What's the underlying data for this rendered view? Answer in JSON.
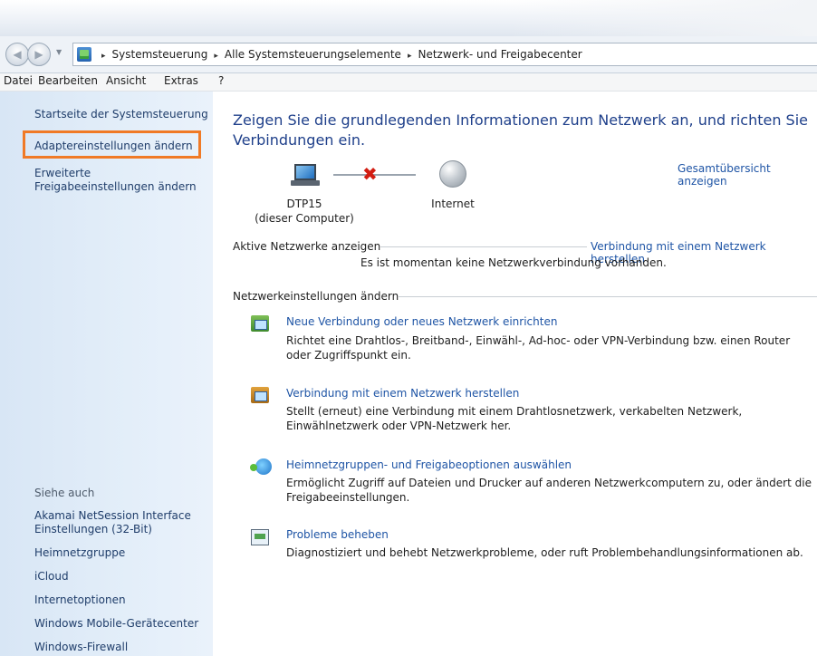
{
  "navbar": {
    "breadcrumbs": [
      "Systemsteuerung",
      "Alle Systemsteuerungselemente",
      "Netzwerk- und Freigabecenter"
    ],
    "separator": "▸"
  },
  "menubar": {
    "items": [
      "Datei",
      "Bearbeiten",
      "Ansicht",
      "Extras",
      "?"
    ]
  },
  "sidebar": {
    "links": [
      "Startseite der Systemsteuerung",
      "Adaptereinstellungen ändern",
      "Erweiterte Freigabeeinstellungen ändern"
    ],
    "see_also_title": "Siehe auch",
    "see_also": [
      "Akamai NetSession Interface Einstellungen (32-Bit)",
      "Heimnetzgruppe",
      "iCloud",
      "Internetoptionen",
      "Windows Mobile-Gerätecenter",
      "Windows-Firewall"
    ]
  },
  "main": {
    "heading": "Zeigen Sie die grundlegenden Informationen zum Netzwerk an, und richten Sie Verbindungen ein.",
    "overview_link": "Gesamtübersicht anzeigen",
    "computer_name": "DTP15",
    "computer_sub": "(dieser Computer)",
    "internet_label": "Internet",
    "active_networks_title": "Aktive Netzwerke anzeigen",
    "connect_link": "Verbindung mit einem Netzwerk herstellen",
    "no_connection_msg": "Es ist momentan keine Netzwerkverbindung vorhanden.",
    "change_settings_title": "Netzwerkeinstellungen ändern",
    "tasks": [
      {
        "title": "Neue Verbindung oder neues Netzwerk einrichten",
        "desc": "Richtet eine Drahtlos-, Breitband-, Einwähl-, Ad-hoc- oder VPN-Verbindung bzw. einen Router oder Zugriffspunkt ein."
      },
      {
        "title": "Verbindung mit einem Netzwerk herstellen",
        "desc": "Stellt (erneut) eine Verbindung mit einem Drahtlosnetzwerk, verkabelten Netzwerk, Einwählnetzwerk oder VPN-Netzwerk her."
      },
      {
        "title": "Heimnetzgruppen- und Freigabeoptionen auswählen",
        "desc": "Ermöglicht Zugriff auf Dateien und Drucker auf anderen Netzwerkcomputern zu, oder ändert die Freigabeeinstellungen."
      },
      {
        "title": "Probleme beheben",
        "desc": "Diagnostiziert und behebt Netzwerkprobleme, oder ruft Problembehandlungsinformationen ab."
      }
    ]
  },
  "colors": {
    "link": "#1e54a5",
    "heading": "#1e3f8a",
    "highlight": "#f07a26",
    "error_x": "#d21d12"
  },
  "icons": {
    "back": "back-arrow-icon",
    "forward": "forward-arrow-icon",
    "computer": "computer-icon",
    "internet": "globe-icon",
    "disconnected": "red-x-icon"
  }
}
